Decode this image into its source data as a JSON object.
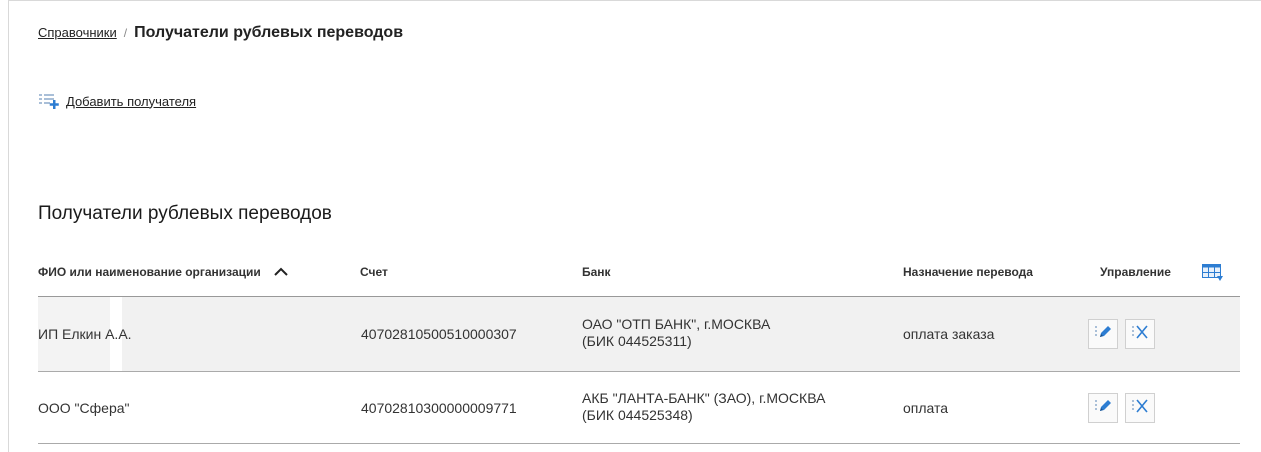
{
  "breadcrumb": {
    "parent": "Справочники",
    "separator": "/",
    "current": "Получатели рублевых переводов"
  },
  "add_recipient": {
    "label": "Добавить получателя",
    "icon": "list-add-icon"
  },
  "section": {
    "title": "Получатели рублевых переводов"
  },
  "table": {
    "columns": [
      "ФИО или наименование организации",
      "Счет",
      "Банк",
      "Назначение перевода",
      "Управление"
    ],
    "sort": {
      "column": "ФИО или наименование организации",
      "direction": "asc"
    },
    "rows": [
      {
        "name": "ИП Елкин А.А.",
        "account": "40702810500510000307",
        "bank_line1": "ОАО \"ОТП БАНК\", г.МОСКВА",
        "bank_line2": "(БИК 044525311)",
        "purpose": "оплата заказа"
      },
      {
        "name": "ООО \"Сфера\"",
        "account": "40702810300000009771",
        "bank_line1": "АКБ \"ЛАНТА-БАНК\" (ЗАО), г.МОСКВА",
        "bank_line2": "(БИК 044525348)",
        "purpose": "оплата"
      }
    ]
  },
  "colors": {
    "accent_blue": "#2d7dd2",
    "row_highlight": "#f1f1f1"
  }
}
